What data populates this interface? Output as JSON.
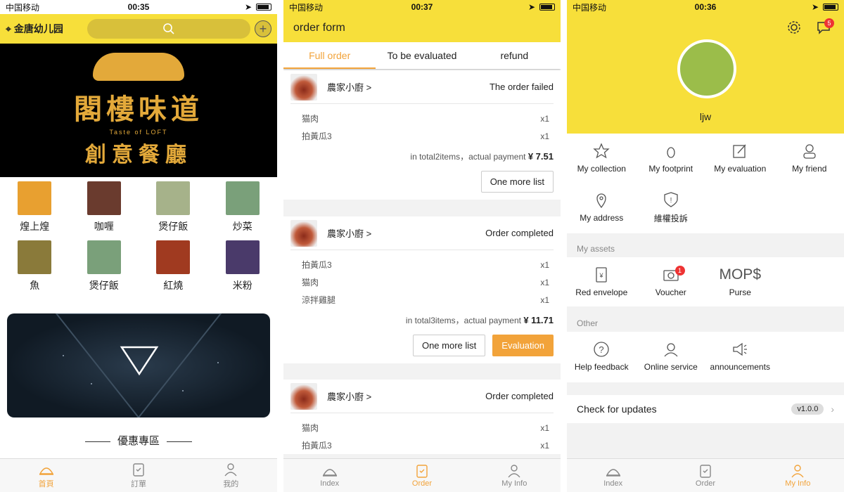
{
  "status_bar": {
    "carrier": "中国移动",
    "time1": "00:35",
    "time2": "00:37",
    "time3": "00:36"
  },
  "home": {
    "location": "金唐幼儿园",
    "banner": {
      "line1": "閣樓味道",
      "sub": "Taste of LOFT",
      "line2": "創意餐廳"
    },
    "categories": [
      {
        "label": "煌上煌",
        "color": "#e8a030"
      },
      {
        "label": "咖喱",
        "color": "#6a3b2e"
      },
      {
        "label": "煲仔飯",
        "color": "#a6b28a"
      },
      {
        "label": "炒菜",
        "color": "#7aa07a"
      },
      {
        "label": "魚",
        "color": "#8a7a3a"
      },
      {
        "label": "煲仔飯",
        "color": "#7aa07a"
      },
      {
        "label": "紅燒",
        "color": "#a03a20"
      },
      {
        "label": "米粉",
        "color": "#4a3a6a"
      }
    ],
    "section_title": "優惠專區",
    "tabs": [
      "首頁",
      "訂單",
      "我的"
    ]
  },
  "orders": {
    "title": "order form",
    "tabs": [
      "Full order",
      "To be evaluated",
      "refund"
    ],
    "list": [
      {
        "shop": "農家小廚 >",
        "status": "The order failed",
        "items": [
          {
            "name": "猫肉",
            "qty": "x1"
          },
          {
            "name": "拍黃瓜3",
            "qty": "x1"
          }
        ],
        "total_text": "in total2items，actual payment",
        "amount": "¥ 7.51",
        "buttons": [
          "One more list"
        ]
      },
      {
        "shop": "農家小廚 >",
        "status": "Order completed",
        "items": [
          {
            "name": "拍黃瓜3",
            "qty": "x1"
          },
          {
            "name": "猫肉",
            "qty": "x1"
          },
          {
            "name": "涼拌雞腿",
            "qty": "x1"
          }
        ],
        "total_text": "in total3items，actual payment",
        "amount": "¥ 11.71",
        "buttons": [
          "One more list",
          "Evaluation"
        ]
      },
      {
        "shop": "農家小廚 >",
        "status": "Order completed",
        "items": [
          {
            "name": "猫肉",
            "qty": "x1"
          },
          {
            "name": "拍黃瓜3",
            "qty": "x1"
          }
        ]
      }
    ],
    "tabbar": [
      "Index",
      "Order",
      "My Info"
    ]
  },
  "profile": {
    "username": "ljw",
    "message_badge": "5",
    "menu": [
      "My collection",
      "My footprint",
      "My evaluation",
      "My friend",
      "My address",
      "維權投訴"
    ],
    "assets_label": "My assets",
    "assets": [
      {
        "label": "Red envelope"
      },
      {
        "label": "Voucher",
        "badge": "1"
      },
      {
        "label": "Purse",
        "value": "MOP$"
      }
    ],
    "other_label": "Other",
    "other": [
      "Help feedback",
      "Online service",
      "announcements"
    ],
    "update_label": "Check for updates",
    "version": "v1.0.0",
    "tabbar": [
      "Index",
      "Order",
      "My Info"
    ]
  },
  "colors": {
    "accent": "#f7df3a",
    "active": "#f2a33a"
  }
}
